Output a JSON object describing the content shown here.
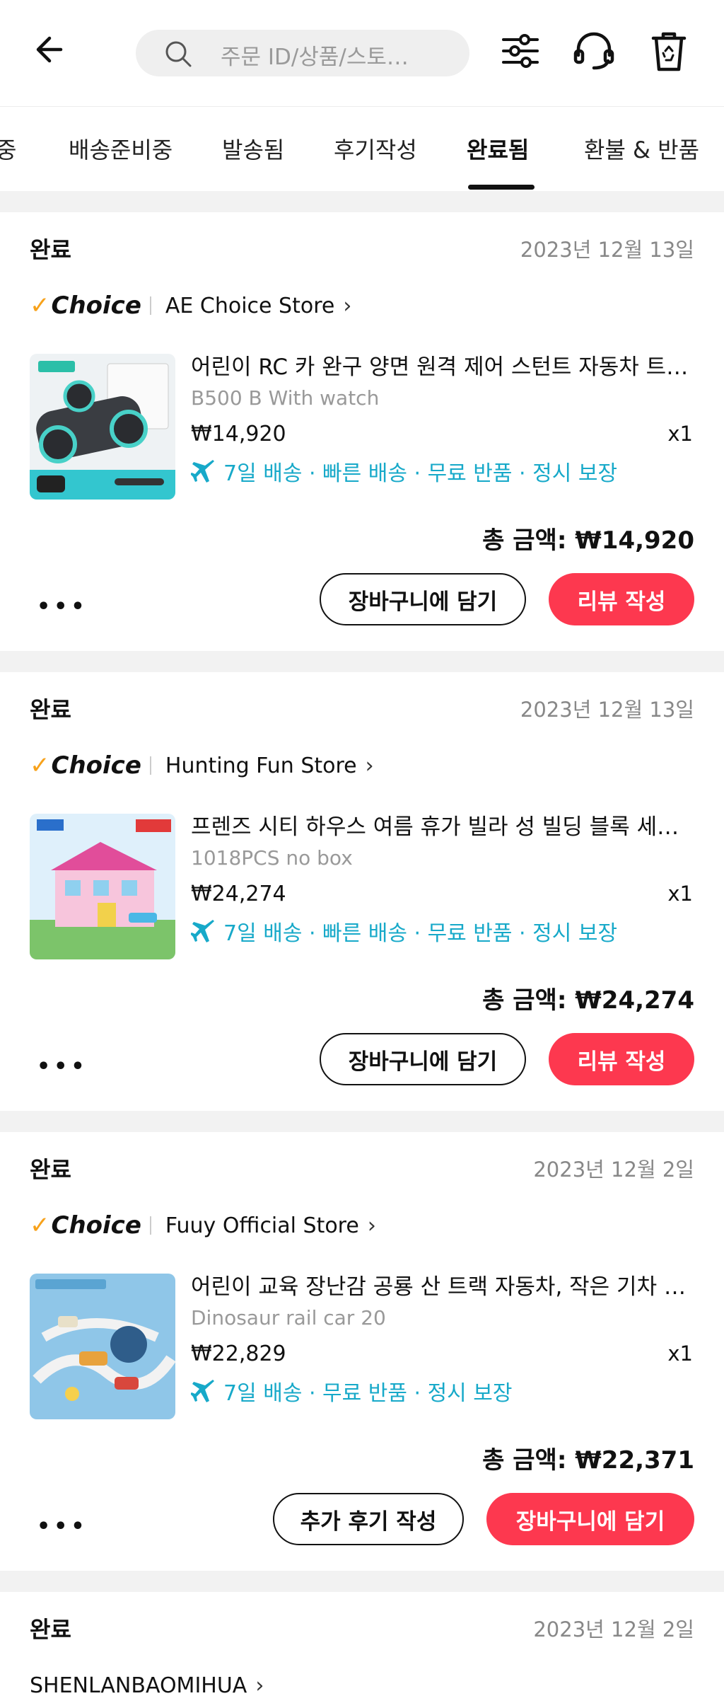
{
  "header": {
    "search_placeholder": "주문 ID/상품/스토…"
  },
  "tabs": [
    {
      "label": "중"
    },
    {
      "label": "배송준비중"
    },
    {
      "label": "발송됨"
    },
    {
      "label": "후기작성"
    },
    {
      "label": "완료됨"
    },
    {
      "label": "환불 & 반품"
    }
  ],
  "active_tab": "완료됨",
  "accent_color": "#fd384f",
  "feature_color": "#17a9c9",
  "orders": [
    {
      "status": "완료",
      "date": "2023년 12월 13일",
      "choice_label": "Choice",
      "store": "AE Choice Store",
      "product_title": "어린이 RC 카 완구 양면 원격 제어 스턴트 자동차 트…",
      "variant": "B500 B With watch",
      "price": "₩14,920",
      "qty": "x1",
      "features": "7일 배송 · 빠른 배송 · 무료 반품 · 정시 보장",
      "total": "총 금액: ₩14,920",
      "more": "•••",
      "btn1": "장바구니에 담기",
      "btn2": "리뷰 작성"
    },
    {
      "status": "완료",
      "date": "2023년 12월 13일",
      "choice_label": "Choice",
      "store": "Hunting Fun Store",
      "product_title": "프렌즈 시티 하우스 여름 휴가 빌라 성 빌딩 블록 세…",
      "variant": "1018PCS no box",
      "price": "₩24,274",
      "qty": "x1",
      "features": "7일 배송 · 빠른 배송 · 무료 반품 · 정시 보장",
      "total": "총 금액: ₩24,274",
      "more": "•••",
      "btn1": "장바구니에 담기",
      "btn2": "리뷰 작성"
    },
    {
      "status": "완료",
      "date": "2023년 12월 2일",
      "choice_label": "Choice",
      "store": "Fuuy Official Store",
      "product_title": "어린이 교육 장난감 공룡 산 트랙 자동차, 작은 기차 …",
      "variant": "Dinosaur rail car 20",
      "price": "₩22,829",
      "qty": "x1",
      "features": "7일 배송 · 무료 반품 · 정시 보장",
      "total": "총 금액: ₩22,371",
      "more": "•••",
      "btn1": "추가 후기 작성",
      "btn2": "장바구니에 담기"
    },
    {
      "status": "완료",
      "date": "2023년 12월 2일",
      "store": "SHENLANBAOMIHUA"
    }
  ]
}
